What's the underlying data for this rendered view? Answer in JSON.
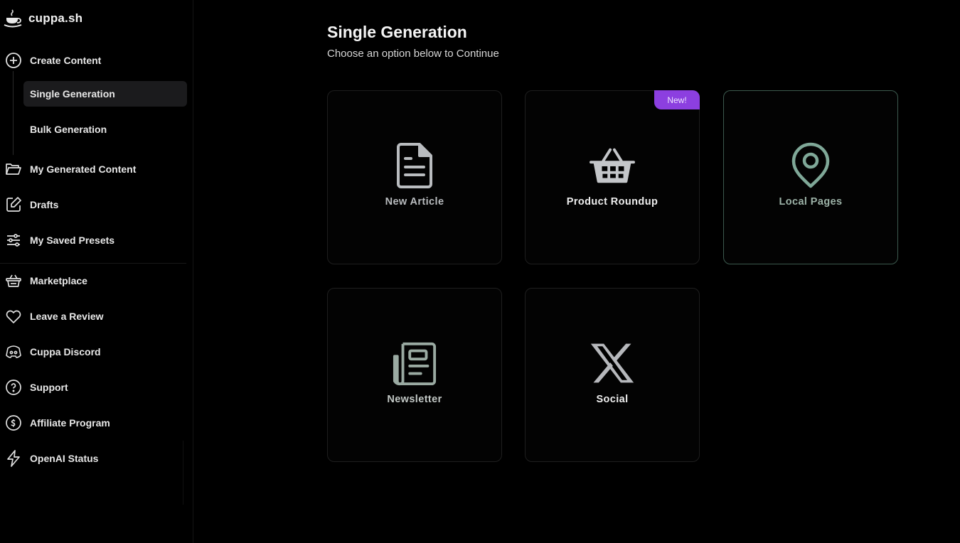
{
  "brand": {
    "name": "cuppa.sh",
    "icon": "coffee-cup-icon"
  },
  "sidebar": {
    "create_content": {
      "label": "Create Content",
      "icon": "plus-circle-icon"
    },
    "sub_items": [
      {
        "label": "Single Generation",
        "active": true
      },
      {
        "label": "Bulk Generation",
        "active": false
      }
    ],
    "items": [
      {
        "label": "My Generated Content",
        "icon": "folder-open-icon"
      },
      {
        "label": "Drafts",
        "icon": "edit-icon"
      },
      {
        "label": "My Saved Presets",
        "icon": "sliders-icon"
      },
      {
        "label": "Marketplace",
        "icon": "basket-icon"
      },
      {
        "label": "Leave a Review",
        "icon": "heart-icon"
      },
      {
        "label": "Cuppa Discord",
        "icon": "discord-icon"
      },
      {
        "label": "Support",
        "icon": "help-circle-icon"
      },
      {
        "label": "Affiliate Program",
        "icon": "dollar-circle-icon"
      },
      {
        "label": "OpenAI Status",
        "icon": "lightning-icon"
      }
    ]
  },
  "main": {
    "title": "Single Generation",
    "subtitle": "Choose an option below to Continue",
    "cards": [
      {
        "label": "New Article",
        "icon": "document-icon"
      },
      {
        "label": "Product Roundup",
        "icon": "shopping-basket-icon",
        "badge": "New!"
      },
      {
        "label": "Local Pages",
        "icon": "map-pin-icon",
        "selected": true
      },
      {
        "label": "Newsletter",
        "icon": "newspaper-icon"
      },
      {
        "label": "Social",
        "icon": "x-logo-icon"
      }
    ]
  },
  "colors": {
    "badge": "#8c3fe0",
    "selected_accent": "#7fa898",
    "background": "#000000"
  }
}
